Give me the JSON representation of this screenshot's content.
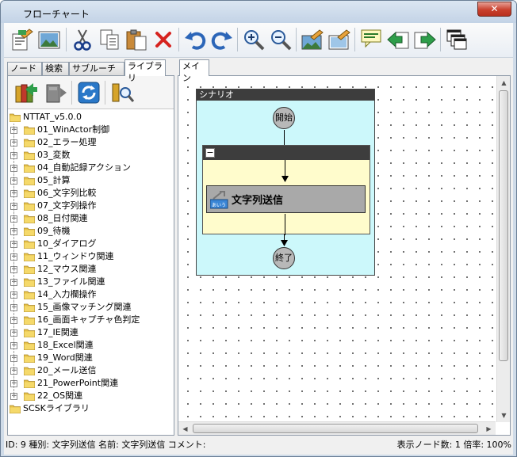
{
  "window": {
    "title": "フローチャート",
    "close_label": "✕"
  },
  "toolbar": {
    "buttons": [
      "edit-properties",
      "image",
      "cut",
      "copy",
      "paste",
      "delete",
      "undo",
      "redo",
      "zoom-in",
      "zoom-out",
      "export-image",
      "import-image",
      "comment",
      "move-back",
      "move-forward",
      "windows"
    ]
  },
  "left_tabs": [
    "ノード",
    "検索",
    "サブルーチン",
    "ライブラリ"
  ],
  "left_tabs_active": "ライブラリ",
  "tree": {
    "root": "NTTAT_v5.0.0",
    "items": [
      "01_WinActor制御",
      "02_エラー処理",
      "03_変数",
      "04_自動記録アクション",
      "05_計算",
      "06_文字列比較",
      "07_文字列操作",
      "08_日付関連",
      "09_待機",
      "10_ダイアログ",
      "11_ウィンドウ関連",
      "12_マウス関連",
      "13_ファイル関連",
      "14_入力欄操作",
      "15_画像マッチング関連",
      "16_画面キャプチャ色判定",
      "17_IE関連",
      "18_Excel関連",
      "19_Word関連",
      "20_メール送信",
      "21_PowerPoint関連",
      "22_OS関連"
    ],
    "second_root": "SCSKライブラリ"
  },
  "right_tabs": [
    "メイン"
  ],
  "canvas": {
    "scenario_label": "シナリオ",
    "start_label": "開始",
    "end_label": "終了",
    "action_label": "文字列送信",
    "action_badge": "あいう"
  },
  "status": {
    "left": "ID: 9  種別: 文字列送信  名前: 文字列送信  コメント:",
    "right": "表示ノード数: 1   倍率: 100%"
  }
}
